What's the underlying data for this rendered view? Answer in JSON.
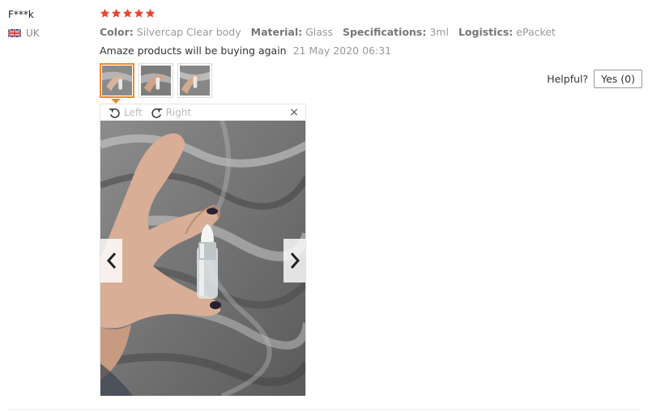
{
  "reviewer": {
    "name": "F***k",
    "country": "UK"
  },
  "rating": {
    "stars": 5,
    "max": 5,
    "color": "#e8452c"
  },
  "attributes": [
    {
      "key": "Color:",
      "value": "Silvercap Clear body"
    },
    {
      "key": "Material:",
      "value": "Glass"
    },
    {
      "key": "Specifications:",
      "value": "3ml"
    },
    {
      "key": "Logistics:",
      "value": "ePacket"
    }
  ],
  "review": {
    "text": "Amaze products will be buying again",
    "date": "21 May 2020 06:31"
  },
  "helpful": {
    "label": "Helpful?",
    "yes_label": "Yes (0)"
  },
  "viewer": {
    "rotate_left_label": "Left",
    "rotate_right_label": "Right",
    "close_glyph": "×",
    "active_thumb_index": 0,
    "thumbnail_count": 3
  },
  "colors": {
    "accent": "#f08a24"
  }
}
